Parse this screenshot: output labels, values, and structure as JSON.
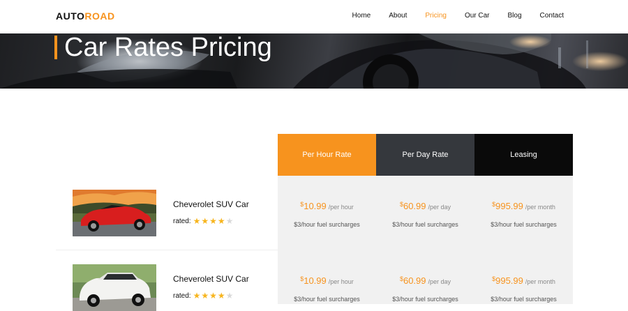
{
  "logo": {
    "part1": "AUTO",
    "part2": "ROAD"
  },
  "nav": {
    "items": [
      {
        "label": "Home"
      },
      {
        "label": "About"
      },
      {
        "label": "Pricing"
      },
      {
        "label": "Our Car"
      },
      {
        "label": "Blog"
      },
      {
        "label": "Contact"
      }
    ],
    "active": "Pricing"
  },
  "hero": {
    "title": "Car Rates Pricing"
  },
  "pricing": {
    "columns": [
      "Per Hour Rate",
      "Per Day Rate",
      "Leasing"
    ],
    "cars": [
      {
        "name": "Cheverolet SUV Car",
        "rated_label": "rated:",
        "rating": 4,
        "max_rating": 5,
        "image": "red-convertible-car-photo",
        "prices": [
          {
            "currency": "$",
            "amount": "10.99",
            "period": "/per hour",
            "surcharge": "$3/hour fuel surcharges"
          },
          {
            "currency": "$",
            "amount": "60.99",
            "period": "/per day",
            "surcharge": "$3/hour fuel surcharges"
          },
          {
            "currency": "$",
            "amount": "995.99",
            "period": "/per month",
            "surcharge": "$3/hour fuel surcharges"
          }
        ]
      },
      {
        "name": "Cheverolet SUV Car",
        "rated_label": "rated:",
        "rating": 4,
        "max_rating": 5,
        "image": "white-suv-car-photo",
        "prices": [
          {
            "currency": "$",
            "amount": "10.99",
            "period": "/per hour",
            "surcharge": "$3/hour fuel surcharges"
          },
          {
            "currency": "$",
            "amount": "60.99",
            "period": "/per day",
            "surcharge": "$3/hour fuel surcharges"
          },
          {
            "currency": "$",
            "amount": "995.99",
            "period": "/per month",
            "surcharge": "$3/hour fuel surcharges"
          }
        ]
      }
    ]
  },
  "colors": {
    "accent": "#f7931e",
    "dark": "#35383d",
    "black": "#0a0a0a",
    "panel": "#f1f1f1",
    "star": "#f7b51e"
  }
}
